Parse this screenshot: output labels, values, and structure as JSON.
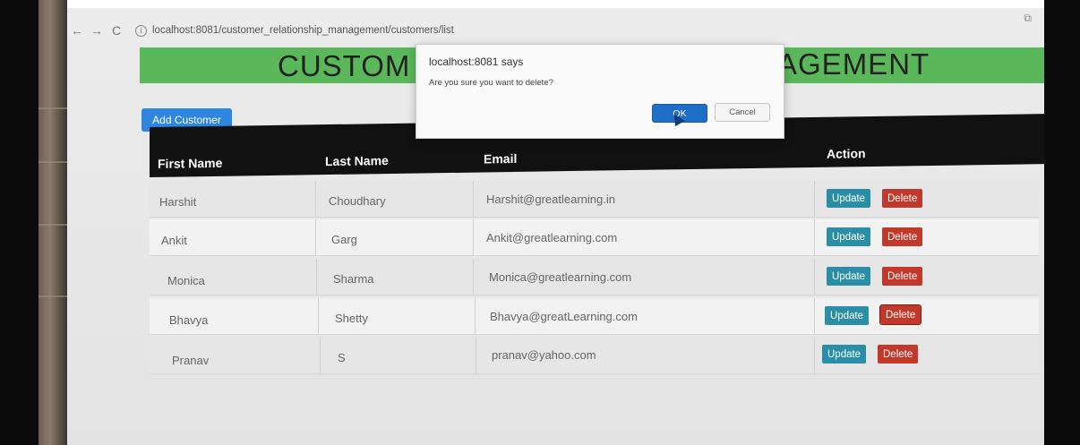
{
  "browser": {
    "url": "localhost:8081/customer_relationship_management/customers/list",
    "back": "←",
    "forward": "→",
    "reload": "C"
  },
  "page": {
    "title_left": "CUSTOM",
    "title_right": "AGEMENT",
    "add_button": "Add Customer"
  },
  "table": {
    "headers": [
      "First Name",
      "Last Name",
      "Email",
      "Action"
    ],
    "rows": [
      {
        "first": "Harshit",
        "last": "Choudhary",
        "email": "Harshit@greatlearning.in"
      },
      {
        "first": "Ankit",
        "last": "Garg",
        "email": "Ankit@greatlearning.com"
      },
      {
        "first": "Monica",
        "last": "Sharma",
        "email": "Monica@greatlearning.com"
      },
      {
        "first": "Bhavya",
        "last": "Shetty",
        "email": "Bhavya@greatLearning.com"
      },
      {
        "first": "Pranav",
        "last": "S",
        "email": "pranav@yahoo.com"
      }
    ],
    "update_label": "Update",
    "delete_label": "Delete"
  },
  "dialog": {
    "title": "localhost:8081 says",
    "message": "Are you sure you want to delete?",
    "ok": "OK",
    "cancel": "Cancel"
  },
  "colors": {
    "banner": "#5ab85a",
    "add_button": "#2e86de",
    "update": "#2a8fa6",
    "delete": "#c0392b",
    "header": "#111111"
  }
}
